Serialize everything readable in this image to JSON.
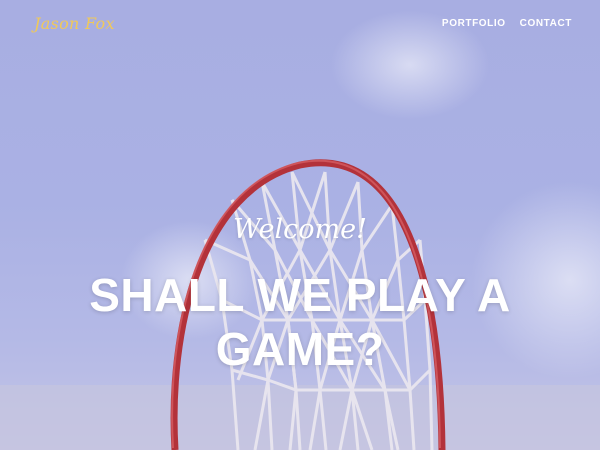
{
  "navbar": {
    "brand": "Jason Fox",
    "links": [
      {
        "label": "PORTFOLIO"
      },
      {
        "label": "CONTACT"
      }
    ]
  },
  "hero": {
    "subheading": "Welcome!",
    "heading": "SHALL WE PLAY A GAME?",
    "background_icon": "basketball-hoop-image"
  },
  "colors": {
    "brand": "#f0c95a",
    "sky": "#a8aee2",
    "rim": "#b3323a",
    "text": "#ffffff"
  }
}
